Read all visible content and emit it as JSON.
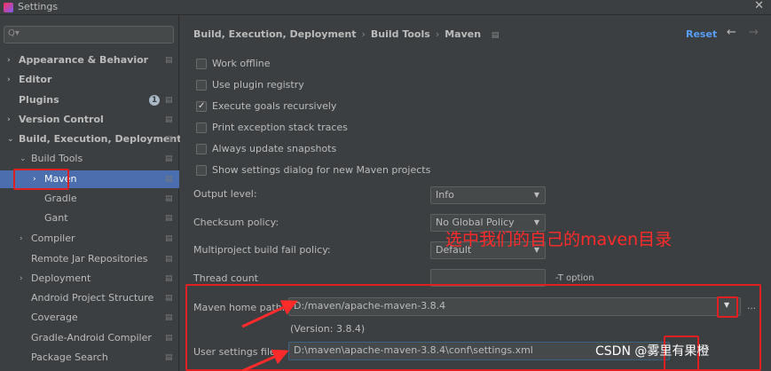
{
  "window": {
    "title": "Settings",
    "close_label": "✕"
  },
  "search": {
    "placeholder": "Q▾"
  },
  "sidebar": {
    "items": [
      {
        "label": "Appearance & Behavior",
        "arrow": "›"
      },
      {
        "label": "Editor",
        "arrow": "›"
      },
      {
        "label": "Plugins",
        "badge": "1"
      },
      {
        "label": "Version Control",
        "arrow": "›"
      },
      {
        "label": "Build, Execution, Deployment",
        "arrow": "⌄"
      },
      {
        "label": "Build Tools",
        "arrow": "⌄"
      },
      {
        "label": "Maven",
        "arrow": "›"
      },
      {
        "label": "Gradle"
      },
      {
        "label": "Gant"
      },
      {
        "label": "Compiler",
        "arrow": "›"
      },
      {
        "label": "Remote Jar Repositories"
      },
      {
        "label": "Deployment",
        "arrow": "›"
      },
      {
        "label": "Android Project Structure"
      },
      {
        "label": "Coverage"
      },
      {
        "label": "Gradle-Android Compiler"
      },
      {
        "label": "Package Search"
      }
    ],
    "selected": "Maven"
  },
  "breadcrumb": {
    "items": [
      "Build, Execution, Deployment",
      "Build Tools",
      "Maven"
    ],
    "separator": "›"
  },
  "header": {
    "reset_label": "Reset",
    "back_label": "←",
    "forward_label": "→"
  },
  "checkboxes": [
    {
      "label": "Work offline",
      "checked": false
    },
    {
      "label": "Use plugin registry",
      "checked": false
    },
    {
      "label": "Execute goals recursively",
      "checked": true
    },
    {
      "label": "Print exception stack traces",
      "checked": false
    },
    {
      "label": "Always update snapshots",
      "checked": false
    },
    {
      "label": "Show settings dialog for new Maven projects",
      "checked": false
    }
  ],
  "form": {
    "output_level": {
      "label": "Output level:",
      "value": "Info"
    },
    "checksum_policy": {
      "label": "Checksum policy:",
      "value": "No Global Policy"
    },
    "multiproject": {
      "label": "Multiproject build fail policy:",
      "value": "Default"
    },
    "thread_count": {
      "label": "Thread count",
      "value": "",
      "hint": "-T option"
    },
    "maven_home": {
      "label": "Maven home path:",
      "value": "D:/maven/apache-maven-3.8.4",
      "version": "(Version: 3.8.4)"
    },
    "user_settings": {
      "label": "User settings file:",
      "value": "D:\\maven\\apache-maven-3.8.4\\conf\\settings.xml"
    }
  },
  "annotation": {
    "text": "选中我们的自己的maven目录",
    "color": "#ff2a2a"
  },
  "watermark": {
    "text": "CSDN @雾里有果橙"
  },
  "colors": {
    "selection": "#4b6eaf",
    "accent": "#589df6",
    "annotation_red": "#e02020"
  }
}
